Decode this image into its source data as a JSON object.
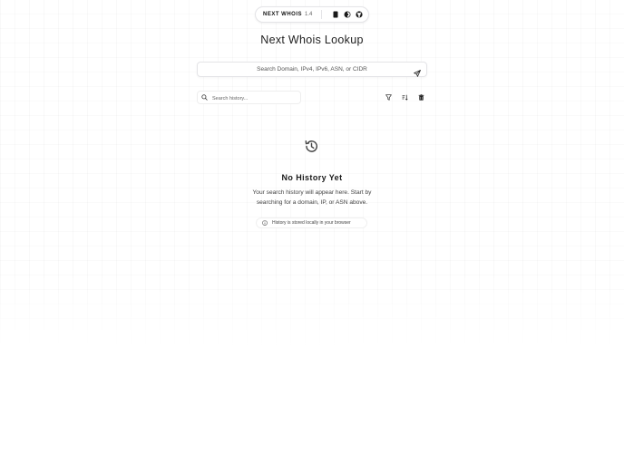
{
  "header": {
    "brand": "NEXT WHOIS",
    "version": "1.4",
    "buttons": [
      {
        "icon": "document-icon"
      },
      {
        "icon": "theme-toggle-icon"
      },
      {
        "icon": "github-icon"
      }
    ]
  },
  "title": "Next Whois Lookup",
  "search": {
    "placeholder": "Search Domain, IPv4, IPv6, ASN, or CIDR",
    "value": ""
  },
  "history": {
    "search_placeholder": "Search history...",
    "tools": [
      "filter-icon",
      "sort-icon",
      "trash-icon"
    ]
  },
  "empty_state": {
    "icon": "history-icon",
    "title": "No History Yet",
    "description": "Your search history will appear here. Start by searching for a domain, IP, or ASN above.",
    "note": "History is stored locally in your browser"
  }
}
